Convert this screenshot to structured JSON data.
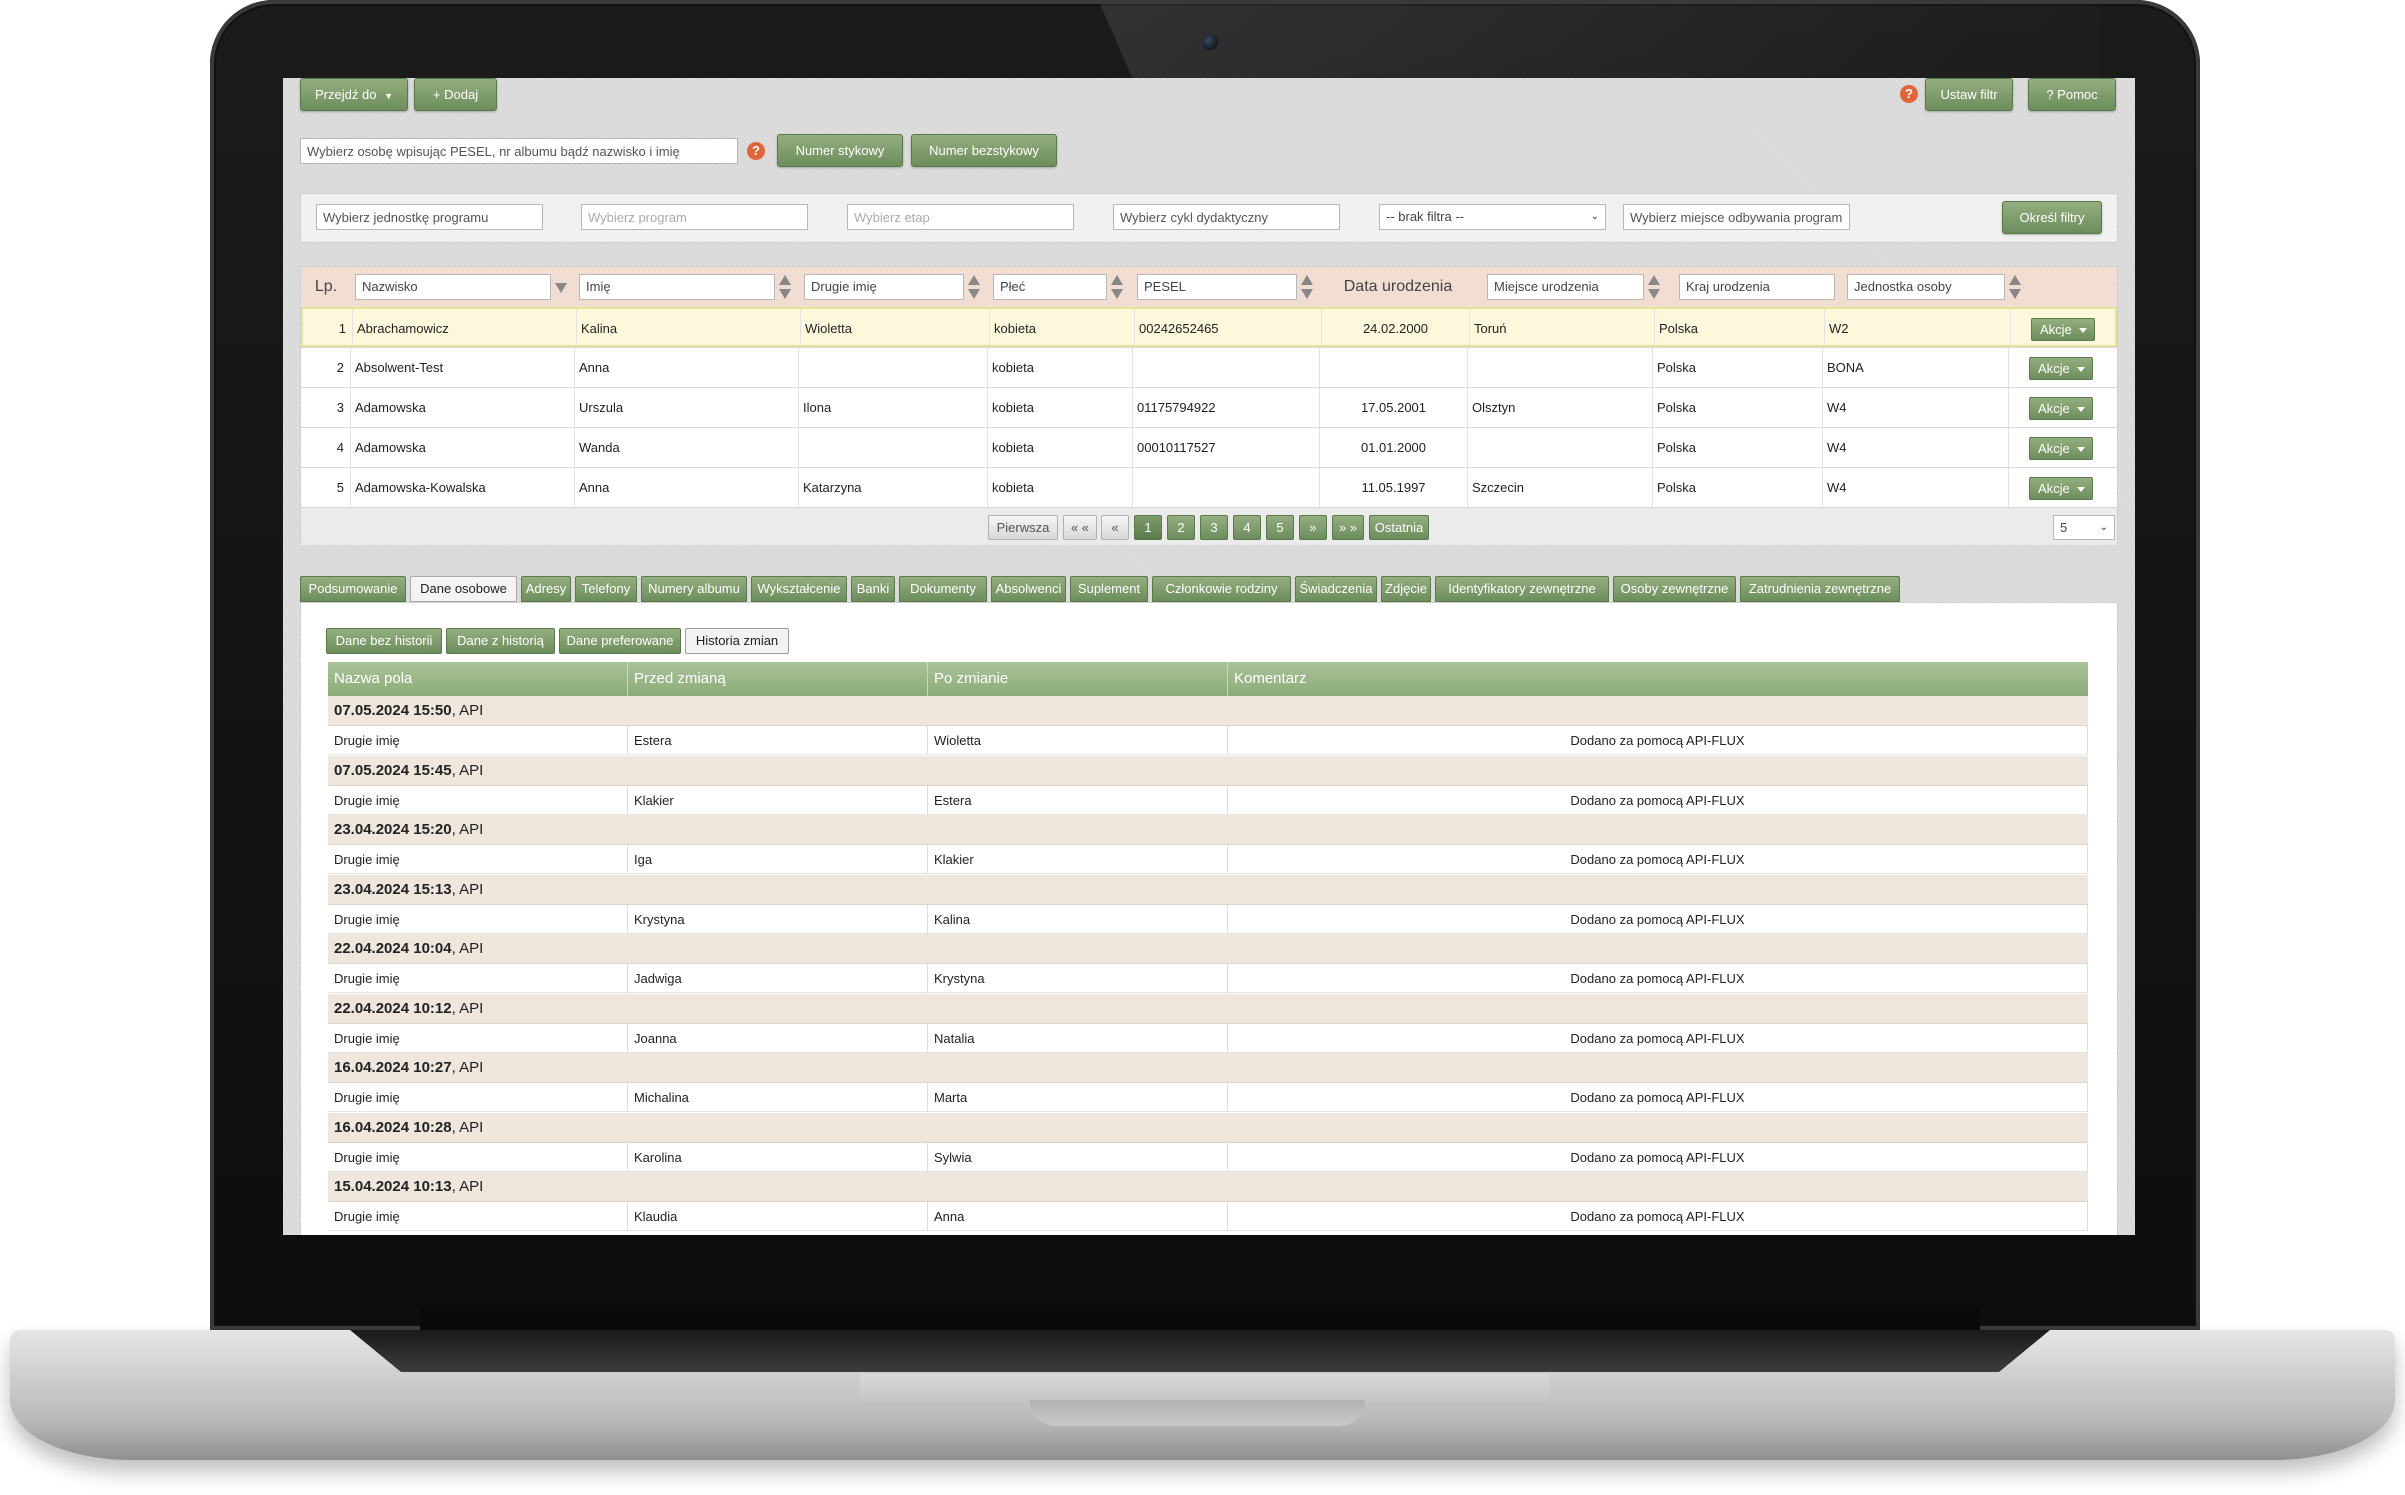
{
  "toolbar": {
    "goto_label": "Przejdź do",
    "add_label": "+ Dodaj",
    "help_symbol": "?",
    "set_filter_label": "Ustaw filtr",
    "help_label": "? Pomoc"
  },
  "search": {
    "placeholder": "Wybierz osobę wpisując PESEL, nr albumu bądź nazwisko i imię",
    "btn_contact": "Numer stykowy",
    "btn_contactless": "Numer bezstykowy"
  },
  "filters": {
    "unit_placeholder": "Wybierz jednostkę programu",
    "program_placeholder": "Wybierz program",
    "stage_placeholder": "Wybierz etap",
    "cycle_placeholder": "Wybierz cykl dydaktyczny",
    "select_value": "-- brak filtra --",
    "place_placeholder": "Wybierz miejsce odbywania programu",
    "apply_label": "Określ filtry"
  },
  "people_table": {
    "headers": {
      "lp": "Lp.",
      "surname": "Nazwisko",
      "name": "Imię",
      "second_name": "Drugie imię",
      "gender": "Płeć",
      "pesel": "PESEL",
      "birth_date": "Data urodzenia",
      "birth_place": "Miejsce urodzenia",
      "birth_country": "Kraj urodzenia",
      "unit": "Jednostka osoby"
    },
    "action_label": "Akcje",
    "rows": [
      {
        "lp": "1",
        "surname": "Abrachamowicz",
        "name": "Kalina",
        "second_name": "Wioletta",
        "gender": "kobieta",
        "pesel": "00242652465",
        "birth_date": "24.02.2000",
        "birth_place": "Toruń",
        "birth_country": "Polska",
        "unit": "W2"
      },
      {
        "lp": "2",
        "surname": "Absolwent-Test",
        "name": "Anna",
        "second_name": "",
        "gender": "kobieta",
        "pesel": "",
        "birth_date": "",
        "birth_place": "",
        "birth_country": "Polska",
        "unit": "BONA"
      },
      {
        "lp": "3",
        "surname": "Adamowska",
        "name": "Urszula",
        "second_name": "Ilona",
        "gender": "kobieta",
        "pesel": "01175794922",
        "birth_date": "17.05.2001",
        "birth_place": "Olsztyn",
        "birth_country": "Polska",
        "unit": "W4"
      },
      {
        "lp": "4",
        "surname": "Adamowska",
        "name": "Wanda",
        "second_name": "",
        "gender": "kobieta",
        "pesel": "00010117527",
        "birth_date": "01.01.2000",
        "birth_place": "",
        "birth_country": "Polska",
        "unit": "W4"
      },
      {
        "lp": "5",
        "surname": "Adamowska-Kowalska",
        "name": "Anna",
        "second_name": "Katarzyna",
        "gender": "kobieta",
        "pesel": "",
        "birth_date": "11.05.1997",
        "birth_place": "Szczecin",
        "birth_country": "Polska",
        "unit": "W4"
      }
    ]
  },
  "pager": {
    "first": "Pierwsza",
    "prev_prev": "« «",
    "prev": "«",
    "pages": [
      "1",
      "2",
      "3",
      "4",
      "5"
    ],
    "active_page": "1",
    "next": "»",
    "next_next": "» »",
    "last": "Ostatnia",
    "page_size": "5"
  },
  "tabs": [
    "Podsumowanie",
    "Dane osobowe",
    "Adresy",
    "Telefony",
    "Numery albumu",
    "Wykształcenie",
    "Banki",
    "Dokumenty",
    "Absolwenci",
    "Suplement",
    "Członkowie rodziny",
    "Świadczenia",
    "Zdjęcie",
    "Identyfikatory zewnętrzne",
    "Osoby zewnętrzne",
    "Zatrudnienia zewnętrzne"
  ],
  "active_tab": "Dane osobowe",
  "subtabs": [
    "Dane bez historii",
    "Dane z historią",
    "Dane preferowane",
    "Historia zmian"
  ],
  "active_subtab": "Historia zmian",
  "history": {
    "headers": {
      "field": "Nazwa pola",
      "before": "Przed zmianą",
      "after": "Po zmianie",
      "comment": "Komentarz"
    },
    "groups": [
      {
        "date": "07.05.2024 15:50",
        "source": ", API",
        "field": "Drugie imię",
        "before": "Estera",
        "after": "Wioletta",
        "comment": "Dodano za pomocą API-FLUX"
      },
      {
        "date": "07.05.2024 15:45",
        "source": ", API",
        "field": "Drugie imię",
        "before": "Klakier",
        "after": "Estera",
        "comment": "Dodano za pomocą API-FLUX"
      },
      {
        "date": "23.04.2024 15:20",
        "source": ", API",
        "field": "Drugie imię",
        "before": "Iga",
        "after": "Klakier",
        "comment": "Dodano za pomocą API-FLUX"
      },
      {
        "date": "23.04.2024 15:13",
        "source": ", API",
        "field": "Drugie imię",
        "before": "Krystyna",
        "after": "Kalina",
        "comment": "Dodano za pomocą API-FLUX"
      },
      {
        "date": "22.04.2024 10:04",
        "source": ", API",
        "field": "Drugie imię",
        "before": "Jadwiga",
        "after": "Krystyna",
        "comment": "Dodano za pomocą API-FLUX"
      },
      {
        "date": "22.04.2024 10:12",
        "source": ", API",
        "field": "Drugie imię",
        "before": "Joanna",
        "after": "Natalia",
        "comment": "Dodano za pomocą API-FLUX"
      },
      {
        "date": "16.04.2024 10:27",
        "source": ", API",
        "field": "Drugie imię",
        "before": "Michalina",
        "after": "Marta",
        "comment": "Dodano za pomocą API-FLUX"
      },
      {
        "date": "16.04.2024 10:28",
        "source": ", API",
        "field": "Drugie imię",
        "before": "Karolina",
        "after": "Sylwia",
        "comment": "Dodano za pomocą API-FLUX"
      },
      {
        "date": "15.04.2024 10:13",
        "source": ", API",
        "field": "Drugie imię",
        "before": "Klaudia",
        "after": "Anna",
        "comment": "Dodano za pomocą API-FLUX"
      }
    ]
  }
}
